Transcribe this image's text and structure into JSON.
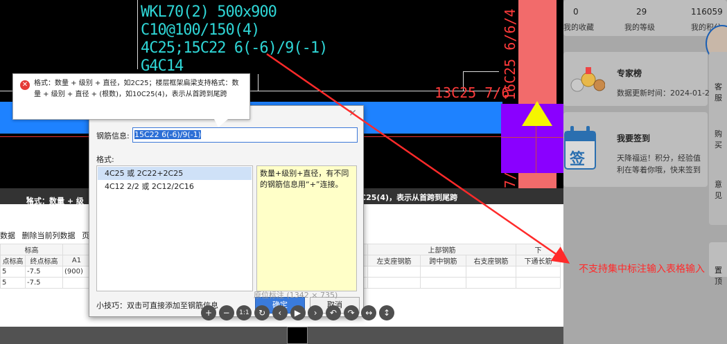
{
  "cad": {
    "beam_label_lines": [
      "WKL70(2) 500x900",
      "C10@100/150(4)",
      "4C25;15C22 6(-6)/9(-1)",
      "G4C14"
    ],
    "red_text_1": "13C25 7/6",
    "red_text_vertical_1": "16C25 6/6/4",
    "red_text_vertical_2": "7/6",
    "status_left": "格式：数量 + 级",
    "status_right": "C25(4)，表示从首跨到尾跨",
    "colors": {
      "beam": "#1e82ff",
      "column": "#f26b6b",
      "support": "#8a00ff",
      "marker": "#f5f500",
      "cad_text": "#2fd6d6"
    }
  },
  "tooltip": {
    "icon": "error-icon",
    "text": "格式：数量 + 级别 + 直径，如2C25；楼层框架扁梁支持格式：数量 + 级别 + 直径 + (根数)，如10C25(4)，表示从首跨到尾跨"
  },
  "dialog": {
    "close_icon": "close-icon",
    "info_label": "钢筋信息:",
    "info_value": "15C22 6(-6)/9(-1)",
    "format_label": "格式:",
    "formats": [
      "4C25 或 2C22+2C25",
      "4C12 2/2 或 2C12/2C16"
    ],
    "description": "数量+级别+直径，有不同的钢筋信息用“+”连接。",
    "tip": "小技巧：双击可直接添加至钢筋信息",
    "ok_label": "确定",
    "cancel_label": "取消",
    "size_text": "原位标注 (1342 × 735)"
  },
  "table": {
    "toolbar": [
      "数据",
      "删除当前列数据",
      "页"
    ],
    "header_group_1": "标高",
    "header_group_2": "上部钢筋",
    "header_group_3": "下",
    "columns": [
      "点标高",
      "终点标高",
      "A1",
      "左支座钢筋",
      "跨中钢筋",
      "右支座钢筋",
      "下通长筋"
    ],
    "rows": [
      [
        "5",
        "-7.5",
        "(900)"
      ],
      [
        "5",
        "-7.5",
        ""
      ]
    ]
  },
  "viewer_tools": [
    {
      "icon": "zoom-in-icon",
      "glyph": "+"
    },
    {
      "icon": "zoom-out-icon",
      "glyph": "−"
    },
    {
      "icon": "actual-size-icon",
      "glyph": "1:1"
    },
    {
      "icon": "refresh-icon",
      "glyph": "↻"
    },
    {
      "icon": "prev-icon",
      "glyph": "‹"
    },
    {
      "icon": "play-icon",
      "glyph": "▶"
    },
    {
      "icon": "next-icon",
      "glyph": "›"
    },
    {
      "icon": "rotate-left-icon",
      "glyph": "↶"
    },
    {
      "icon": "rotate-right-icon",
      "glyph": "↷"
    },
    {
      "icon": "flip-horizontal-icon",
      "glyph": "↔"
    },
    {
      "icon": "flip-vertical-icon",
      "glyph": "↕"
    }
  ],
  "right_panel": {
    "stats": [
      {
        "value": "0",
        "label": "我的收藏"
      },
      {
        "value": "29",
        "label": "我的等级"
      },
      {
        "value": "116059",
        "label": "我的积分"
      }
    ],
    "expert_title": "专家榜",
    "expert_sub": "数据更新时间：2024-01-2",
    "signin_title": "我要签到",
    "signin_sub_1": "天降福运！积分，经验值",
    "signin_sub_2": "利在等着你哦，快来签到",
    "signin_icon_text": "签",
    "side_labels": [
      "客服",
      "购买",
      "意见",
      "置顶"
    ],
    "annotation": "不支持集中标注输入表格输入"
  }
}
